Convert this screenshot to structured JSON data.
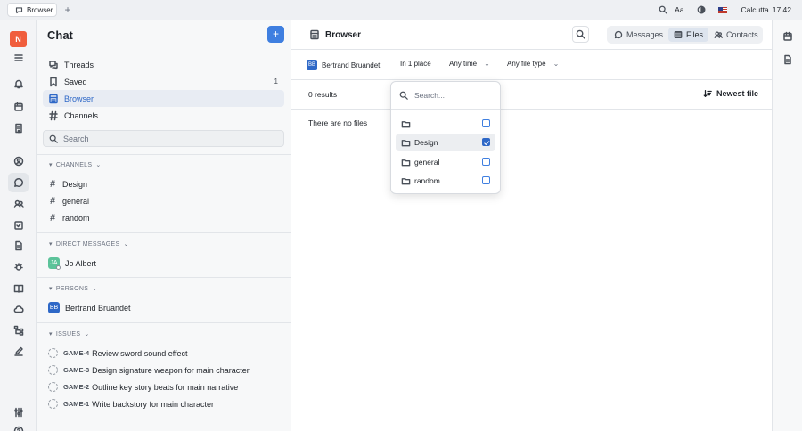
{
  "topbar": {
    "tab_label": "Browser",
    "add_tab": "+",
    "font_label": "Aa",
    "location": "Calcutta",
    "time": "17 42"
  },
  "rail": {
    "logo_letter": "N"
  },
  "nav": {
    "title": "Chat",
    "new_button": "+",
    "items": [
      {
        "label": "Threads",
        "icon": "threads-icon"
      },
      {
        "label": "Saved",
        "icon": "bookmark-icon",
        "count": "1"
      },
      {
        "label": "Browser",
        "icon": "browser-icon"
      },
      {
        "label": "Channels",
        "icon": "channels-icon"
      }
    ],
    "search_placeholder": "Search",
    "channels_header": "CHANNELS",
    "channels": [
      "Design",
      "general",
      "random"
    ],
    "dm_header": "DIRECT MESSAGES",
    "dms": [
      {
        "initials": "JA",
        "name": "Jo Albert",
        "color": "#5cc39a"
      }
    ],
    "persons_header": "PERSONS",
    "persons": [
      {
        "initials": "BB",
        "name": "Bertrand Bruandet",
        "color": "#2e68c7"
      }
    ],
    "issues_header": "ISSUES",
    "issues": [
      {
        "id": "GAME-4",
        "title": "Review sword sound effect"
      },
      {
        "id": "GAME-3",
        "title": "Design signature weapon for main character"
      },
      {
        "id": "GAME-2",
        "title": "Outline key story beats for main narrative"
      },
      {
        "id": "GAME-1",
        "title": "Write backstory for main character"
      }
    ]
  },
  "main": {
    "title": "Browser",
    "tabs": [
      {
        "label": "Messages",
        "active": false
      },
      {
        "label": "Files",
        "active": true
      },
      {
        "label": "Contacts",
        "active": false
      }
    ],
    "filters": {
      "person_initials": "BB",
      "person": "Bertrand Bruandet",
      "place": "In 1 place",
      "time": "Any time",
      "file_type": "Any file type"
    },
    "results": "0 results",
    "sort": "Newest file",
    "empty": "There are no files"
  },
  "popup": {
    "search_placeholder": "Search...",
    "options": [
      {
        "label": "",
        "checked": false
      },
      {
        "label": "Design",
        "checked": true
      },
      {
        "label": "general",
        "checked": false
      },
      {
        "label": "random",
        "checked": false
      }
    ]
  },
  "colors": {
    "accent": "#2e68c7",
    "logo": "#f05d3c"
  }
}
